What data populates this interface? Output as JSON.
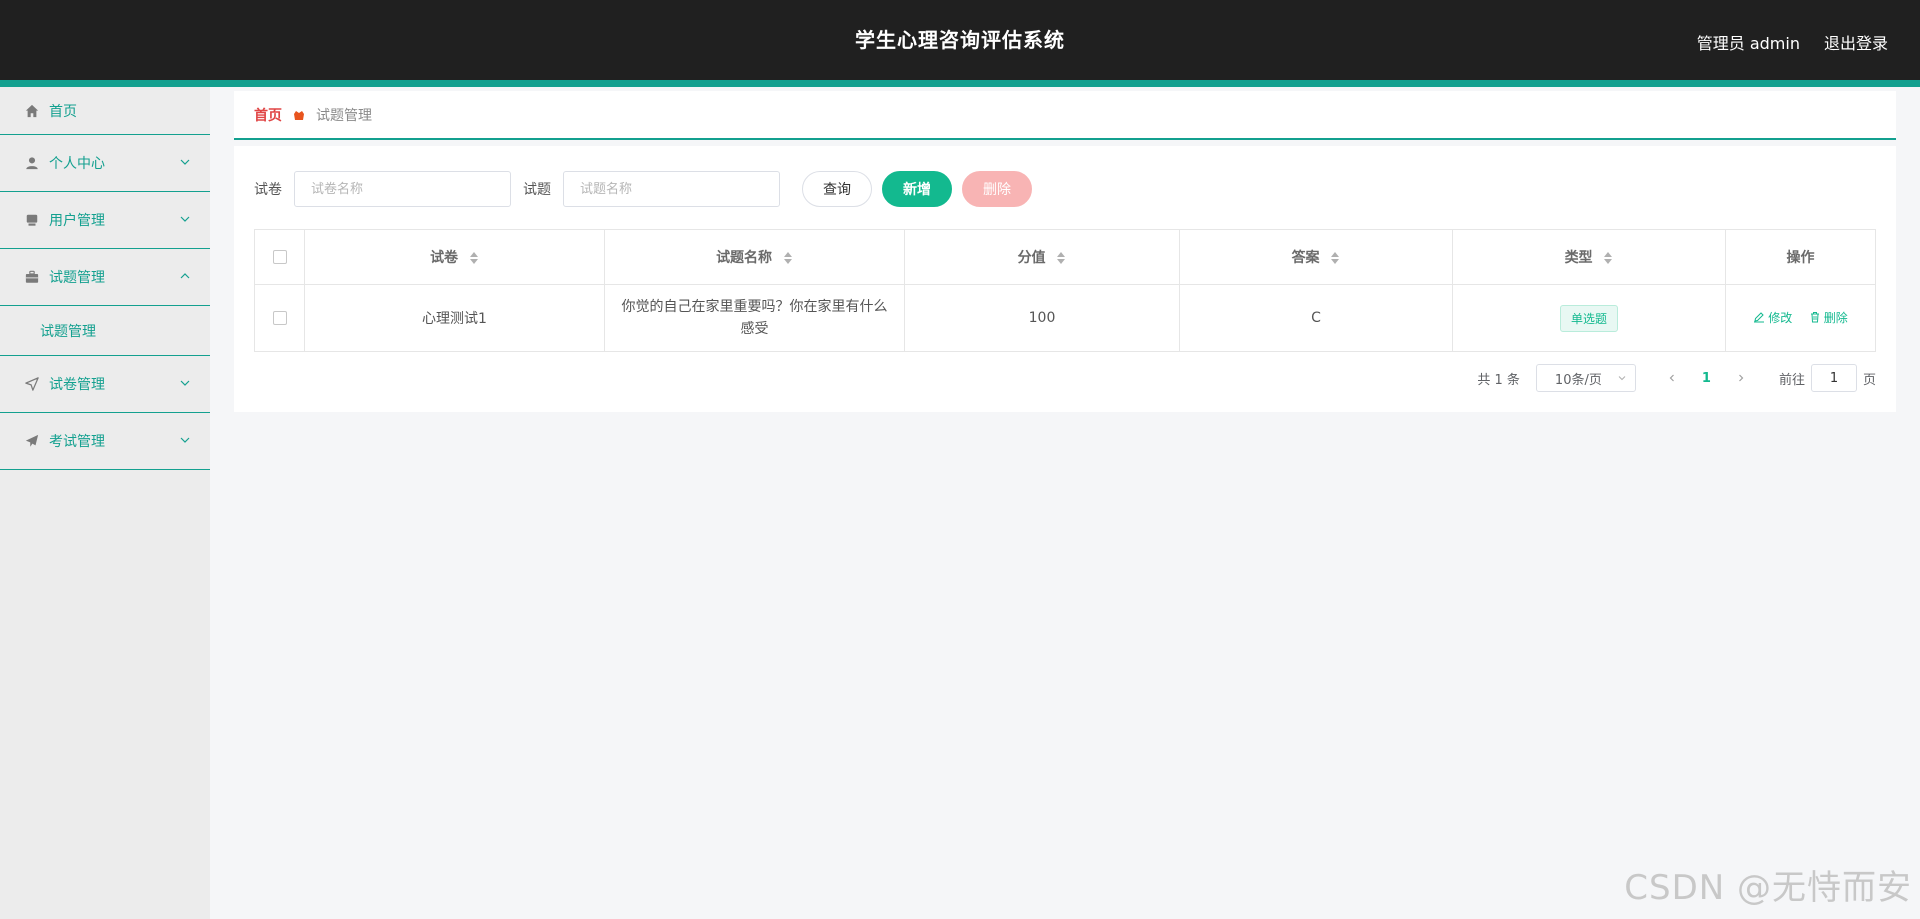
{
  "header": {
    "title": "学生心理咨询评估系统",
    "user": "管理员 admin",
    "logout": "退出登录"
  },
  "sidebar": {
    "items": [
      {
        "label": "首页",
        "icon": "home-icon"
      },
      {
        "label": "个人中心",
        "icon": "user-icon"
      },
      {
        "label": "用户管理",
        "icon": "users-icon"
      },
      {
        "label": "试题管理",
        "icon": "briefcase-icon",
        "expanded": true,
        "sub": [
          "试题管理"
        ]
      },
      {
        "label": "试卷管理",
        "icon": "navigation-icon"
      },
      {
        "label": "考试管理",
        "icon": "send-icon"
      }
    ]
  },
  "breadcrumb": {
    "home": "首页",
    "current": "试题管理"
  },
  "search": {
    "paper_label": "试卷",
    "paper_placeholder": "试卷名称",
    "question_label": "试题",
    "question_placeholder": "试题名称",
    "query_button": "查询",
    "add_button": "新增",
    "delete_button": "删除"
  },
  "table": {
    "headers": [
      "试卷",
      "试题名称",
      "分值",
      "答案",
      "类型",
      "操作"
    ],
    "rows": [
      {
        "paper": "心理测试1",
        "question": "你觉的自己在家里重要吗？你在家里有什么感受",
        "score": "100",
        "answer": "C",
        "type": "单选题",
        "edit": "修改",
        "delete": "删除"
      }
    ]
  },
  "pagination": {
    "total": "共 1 条",
    "page_size": "10条/页",
    "current_page": "1",
    "goto_label": "前往",
    "goto_value": "1",
    "page_unit": "页"
  },
  "watermark": "CSDN @无恃而安",
  "colors": {
    "header_bg": "#202020",
    "accent": "#13a08f",
    "primary_button": "#13b98f",
    "danger_button": "#f8b4b4",
    "breadcrumb_home": "#e04545"
  }
}
